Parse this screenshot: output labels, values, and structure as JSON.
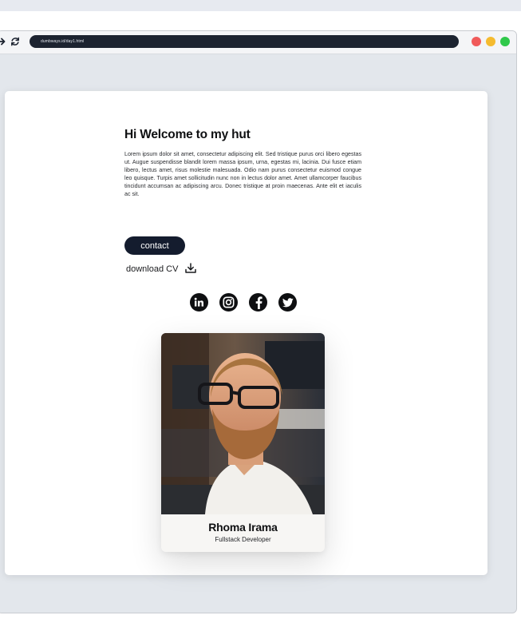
{
  "browser": {
    "url": "dumbways.id/day1.html",
    "icons": [
      "arrow-right-icon",
      "refresh-icon"
    ],
    "window_dots": [
      "#f05a5a",
      "#f5bb2f",
      "#2fc84a"
    ]
  },
  "hero": {
    "title": "Hi Welcome to my hut",
    "paragraph": "Lorem ipsum dolor sit amet, consectetur adipiscing elit. Sed tristique purus orci libero egestas ut. Augue suspendisse blandit lorem massa ipsum, urna, egestas mi, lacinia. Dui fusce etiam libero, lectus amet, risus molestie malesuada. Odio nam purus consectetur euismod congue leo quisque. Turpis amet sollicitudin nunc non in lectus dolor amet. Amet ullamcorper faucibus tincidunt accumsan ac adipiscing arcu. Donec tristique at proin maecenas. Ante elit et iaculis ac sit.",
    "contact_label": "contact",
    "download_label": "download CV"
  },
  "social": [
    "linkedin-icon",
    "instagram-icon",
    "facebook-icon",
    "twitter-icon"
  ],
  "profile": {
    "name": "Rhoma Irama",
    "role": "Fullstack Developer"
  },
  "colors": {
    "accent": "#141c2e",
    "page_background": "#e3e7ec",
    "address_bar": "#1c2330"
  }
}
